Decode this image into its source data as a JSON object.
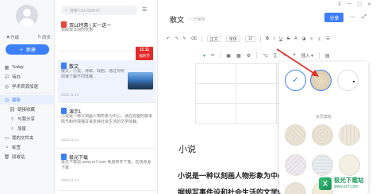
{
  "sidebar": {
    "upgrade_label": "升级",
    "sync_label": "同步",
    "new_button": "新建",
    "nav": [
      {
        "label": "Today",
        "icon": "calendar-icon",
        "active": false,
        "sub": false
      },
      {
        "label": "待办",
        "icon": "todo-icon",
        "active": false,
        "sub": false
      },
      {
        "label": "学术資源加速",
        "icon": "academic-icon",
        "active": false,
        "sub": false
      },
      {
        "label": "最新",
        "icon": "clock-icon",
        "active": true,
        "sub": false
      },
      {
        "label": "链接收藏",
        "icon": "link-icon",
        "active": false,
        "sub": true
      },
      {
        "label": "与我分享",
        "icon": "share-icon",
        "active": false,
        "sub": true
      },
      {
        "label": "加星",
        "icon": "star-icon",
        "active": false,
        "sub": true
      },
      {
        "label": "我的文件夹",
        "icon": "folder-icon",
        "active": false,
        "sub": false
      },
      {
        "label": "标签",
        "icon": "tag-icon",
        "active": false,
        "sub": false
      },
      {
        "label": "回收站",
        "icon": "trash-icon",
        "active": false,
        "sub": false
      }
    ],
    "nav_extra": [
      "与我分享",
      "加星"
    ]
  },
  "list": {
    "search_placeholder": "搜索 Ctrl+Shift+F",
    "notes": [
      {
        "title": "双11特惠 | 买一送一",
        "body": "领取双11限时优惠",
        "date": "",
        "icon": "red"
      },
      {
        "title": "散文",
        "body": "散文，小说，诗歌，戏剧，通过对照阅读了解不同体裁...",
        "date": "2022.11.14",
        "icon": "blue"
      },
      {
        "title": "演示1",
        "body": "小说是一种以刻画人物形象为中心，通过完整的故事情节和环境描写来反映社会生活的文学体裁。",
        "date": "2022.11.14",
        "icon": "blue"
      },
      {
        "title": "极光下载",
        "body": "极光下载站 www.xz7.com 免费软件下载，在线资源下载",
        "date": "2022.11.14",
        "icon": "blue"
      }
    ],
    "promo_badge": {
      "top": "11.11",
      "bottom": "福利节"
    }
  },
  "editor": {
    "title": "散文",
    "saved": "已保存",
    "share_button": "分享",
    "toolbar1": [
      "正文",
      "宋体",
      "12",
      "B",
      "I",
      "U",
      "S"
    ],
    "toolbar2_insert": "插入",
    "heading": "小说",
    "para1": "小说是一种以刻画人物形象为中心",
    "para2": "据规写事件设和社会生活的文学体"
  },
  "popup": {
    "vip_label": "会员模板"
  },
  "watermark": {
    "line1": "极光下载站",
    "line2": "www.xz7.com"
  },
  "colors": {
    "accent": "#3d7ef9",
    "promo_red": "#e42b2b",
    "arrow_red": "#e0332b"
  }
}
